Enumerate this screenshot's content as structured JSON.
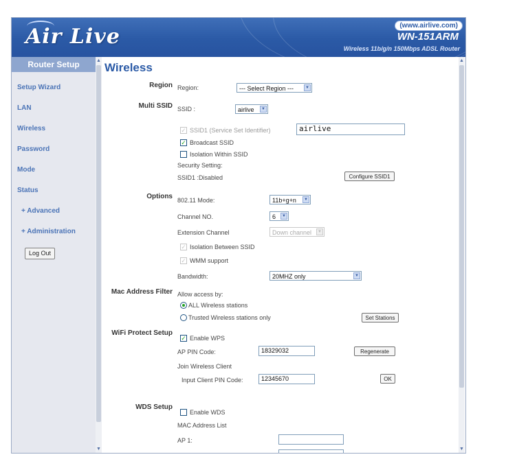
{
  "header": {
    "logo": "Air Live",
    "url": "(www.airlive.com)",
    "model": "WN-151ARM",
    "tagline": "Wireless 11b/g/n 150Mbps ADSL Router"
  },
  "sidebar": {
    "title": "Router Setup",
    "items": [
      {
        "label": "Setup Wizard"
      },
      {
        "label": "LAN"
      },
      {
        "label": "Wireless"
      },
      {
        "label": "Password"
      },
      {
        "label": "Mode"
      },
      {
        "label": "Status"
      },
      {
        "label": "+ Advanced"
      },
      {
        "label": "+ Administration"
      }
    ],
    "logout_label": "Log Out"
  },
  "page": {
    "title": "Wireless"
  },
  "region": {
    "section": "Region",
    "label": "Region:",
    "value": "--- Select Region ---"
  },
  "multi_ssid": {
    "section": "Multi SSID",
    "ssid_label": "SSID :",
    "ssid_value": "airlive",
    "ssid1_label": "SSID1 (Service Set Identifier)",
    "ssid1_value": "airlive",
    "broadcast_label": "Broadcast SSID",
    "isolation_label": "Isolation Within SSID",
    "security_label": "Security Setting:",
    "security_value": "SSID1 :Disabled",
    "configure_label": "Configure SSID1"
  },
  "options": {
    "section": "Options",
    "mode_label": "802.11 Mode:",
    "mode_value": "11b+g+n",
    "channel_label": "Channel NO.",
    "channel_value": "6",
    "ext_label": "Extension Channel",
    "ext_value": "Down channel",
    "isolation_between_label": "Isolation Between SSID",
    "wmm_label": "WMM support",
    "bandwidth_label": "Bandwidth:",
    "bandwidth_value": "20MHZ only"
  },
  "mac_filter": {
    "section": "Mac Address Filter",
    "allow_label": "Allow access by:",
    "all_label": "ALL Wireless stations",
    "trusted_label": "Trusted Wireless stations only",
    "set_stations_label": "Set Stations"
  },
  "wps": {
    "section": "WiFi Protect Setup",
    "enable_label": "Enable WPS",
    "pin_label": "AP PIN Code:",
    "pin_value": "18329032",
    "regenerate_label": "Regenerate",
    "join_label": "Join Wireless Client",
    "client_pin_label": "Input Client PIN Code:",
    "client_pin_value": "12345670",
    "ok_label": "OK"
  },
  "wds": {
    "section": "WDS Setup",
    "enable_label": "Enable WDS",
    "mac_list_label": "MAC Address List",
    "ap1_label": "AP 1:"
  }
}
